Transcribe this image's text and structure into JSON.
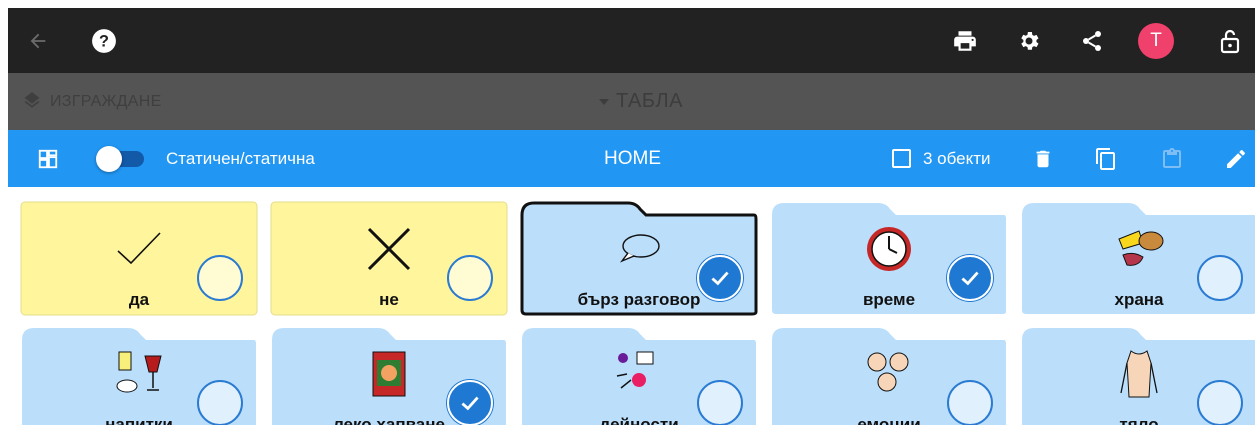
{
  "app": {
    "top_icons": [
      "back-arrow-icon",
      "help-icon",
      "print-icon",
      "settings-icon",
      "share-icon",
      "avatar",
      "lock-icon"
    ],
    "avatar_letter": "T",
    "avatar_color": "#f0416c"
  },
  "subbar": {
    "build_label": "ИЗГРАЖДАНЕ",
    "boards_label": "ТАБЛА"
  },
  "editbar": {
    "static_toggle_label": "Статичен/статична",
    "board_name": "HOME",
    "selected_count_label": "3 обекти"
  },
  "tiles": [
    {
      "label": "да",
      "type": "button",
      "color": "#fff59d",
      "selected": false,
      "icon": "checkmark-symbol"
    },
    {
      "label": "не",
      "type": "button",
      "color": "#fff59d",
      "selected": false,
      "icon": "cross-symbol"
    },
    {
      "label": "бърз разговор",
      "type": "folder",
      "color": "#bbdefb",
      "selected": true,
      "icon": "speech-bubble-symbol"
    },
    {
      "label": "време",
      "type": "folder",
      "color": "#bbdefb",
      "selected": true,
      "icon": "clock-symbol"
    },
    {
      "label": "храна",
      "type": "folder",
      "color": "#bbdefb",
      "selected": false,
      "icon": "food-symbol"
    },
    {
      "label": "напитки",
      "type": "folder",
      "color": "#bbdefb",
      "selected": false,
      "icon": "drinks-symbol"
    },
    {
      "label": "леко хапване",
      "type": "folder",
      "color": "#bbdefb",
      "selected": true,
      "icon": "snack-symbol"
    },
    {
      "label": "дейности",
      "type": "folder",
      "color": "#bbdefb",
      "selected": false,
      "icon": "activities-symbol"
    },
    {
      "label": "емоции",
      "type": "folder",
      "color": "#bbdefb",
      "selected": false,
      "icon": "emotions-symbol"
    },
    {
      "label": "тяло",
      "type": "folder",
      "color": "#bbdefb",
      "selected": false,
      "icon": "body-symbol"
    }
  ]
}
